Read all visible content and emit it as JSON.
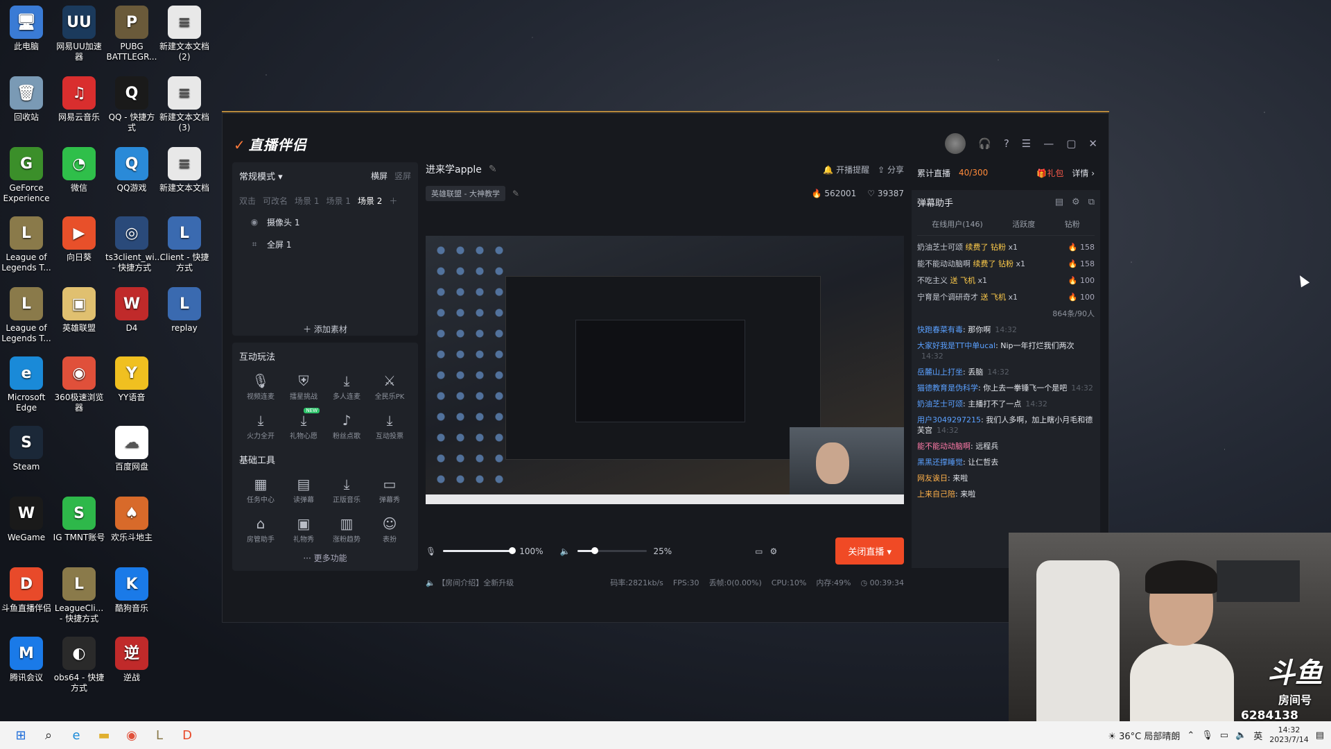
{
  "desktop": {
    "icons": [
      {
        "label": "此电脑",
        "icon": "computer-icon",
        "color": "#3a7bd5",
        "glyph": "🖥"
      },
      {
        "label": "网易UU加速器",
        "icon": "uu-accelerator-icon",
        "color": "#1b3a5c",
        "glyph": "UU"
      },
      {
        "label": "PUBG BATTLEGR...",
        "icon": "pubg-icon",
        "color": "#6a5a3a",
        "glyph": "P"
      },
      {
        "label": "新建文本文档 (2)",
        "icon": "text-file-icon",
        "color": "#e8e8e8",
        "glyph": "≡"
      },
      {
        "label": "回收站",
        "icon": "recycle-bin-icon",
        "color": "#7a9ab5",
        "glyph": "🗑"
      },
      {
        "label": "网易云音乐",
        "icon": "netease-music-icon",
        "color": "#d92e2e",
        "glyph": "♫"
      },
      {
        "label": "QQ - 快捷方式",
        "icon": "qq-icon",
        "color": "#1a1a1a",
        "glyph": "Q"
      },
      {
        "label": "新建文本文档 (3)",
        "icon": "text-file-icon",
        "color": "#e8e8e8",
        "glyph": "≡"
      },
      {
        "label": "GeForce Experience",
        "icon": "geforce-icon",
        "color": "#3b8f2a",
        "glyph": "G"
      },
      {
        "label": "微信",
        "icon": "wechat-icon",
        "color": "#2fbf4a",
        "glyph": "◔"
      },
      {
        "label": "QQ游戏",
        "icon": "qq-game-icon",
        "color": "#2a8ad8",
        "glyph": "Q"
      },
      {
        "label": "新建文本文档",
        "icon": "text-file-icon",
        "color": "#e8e8e8",
        "glyph": "≡"
      },
      {
        "label": "League of Legends T...",
        "icon": "lol-icon",
        "color": "#8a7a4a",
        "glyph": "L"
      },
      {
        "label": "向日葵",
        "icon": "sunflower-icon",
        "color": "#e8502a",
        "glyph": "▶"
      },
      {
        "label": "ts3client_wi... - 快捷方式",
        "icon": "teamspeak-icon",
        "color": "#2a4a7a",
        "glyph": "◎"
      },
      {
        "label": "Client - 快捷方式",
        "icon": "lol-client-icon",
        "color": "#3a6ab0",
        "glyph": "L"
      },
      {
        "label": "League of Legends T...",
        "icon": "lol-icon",
        "color": "#8a7a4a",
        "glyph": "L"
      },
      {
        "label": "英雄联盟",
        "icon": "lol-folder-icon",
        "color": "#e0c070",
        "glyph": "▣"
      },
      {
        "label": "D4",
        "icon": "d4-icon",
        "color": "#c02a2a",
        "glyph": "W"
      },
      {
        "label": "replay",
        "icon": "replay-icon",
        "color": "#3a6ab0",
        "glyph": "L"
      },
      {
        "label": "Microsoft Edge",
        "icon": "edge-icon",
        "color": "#1a8ad8",
        "glyph": "e"
      },
      {
        "label": "360极速浏览器",
        "icon": "360-browser-icon",
        "color": "#e0503a",
        "glyph": "◉"
      },
      {
        "label": "YY语音",
        "icon": "yy-icon",
        "color": "#f0c020",
        "glyph": "Y"
      },
      {
        "label": "Steam",
        "icon": "steam-icon",
        "color": "#1b2838",
        "glyph": "S"
      },
      {
        "label": "百度网盘",
        "icon": "baidu-netdisk-icon",
        "color": "#ffffff",
        "glyph": "☁"
      },
      {
        "label": "WeGame",
        "icon": "wegame-icon",
        "color": "#1a1a1a",
        "glyph": "W"
      },
      {
        "label": "IG TMNT账号",
        "icon": "ig-tmnt-icon",
        "color": "#2eb84a",
        "glyph": "S"
      },
      {
        "label": "欢乐斗地主",
        "icon": "doudizhu-icon",
        "color": "#d86a2a",
        "glyph": "♠"
      },
      {
        "label": "斗鱼直播伴侣",
        "icon": "douyu-companion-icon",
        "color": "#e84a2a",
        "glyph": "D"
      },
      {
        "label": "LeagueCli... - 快捷方式",
        "icon": "lol-client-icon",
        "color": "#8a7a4a",
        "glyph": "L"
      },
      {
        "label": "酷狗音乐",
        "icon": "kugou-icon",
        "color": "#1a7ae8",
        "glyph": "K"
      },
      {
        "label": "腾讯会议",
        "icon": "tencent-meeting-icon",
        "color": "#1a7ae8",
        "glyph": "M"
      },
      {
        "label": "obs64 - 快捷方式",
        "icon": "obs-icon",
        "color": "#2a2a2a",
        "glyph": "◐"
      },
      {
        "label": "逆战",
        "icon": "nizhan-icon",
        "color": "#c02a2a",
        "glyph": "逆"
      }
    ]
  },
  "app": {
    "name": "直播伴侣",
    "left": {
      "mode": "常规模式",
      "orient_h": "横屏",
      "orient_v": "竖屏",
      "scenes": [
        "双击",
        "可改名",
        "场景 1",
        "场景 1",
        "场景 2"
      ],
      "sources": [
        {
          "label": "摄像头 1",
          "icon": "camera-icon"
        },
        {
          "label": "全屏 1",
          "icon": "fullscreen-icon"
        }
      ],
      "add_source": "添加素材",
      "interactive_title": "互动玩法",
      "interactive": [
        {
          "label": "视频连麦",
          "icon": "mic-link-icon",
          "glyph": "🎙"
        },
        {
          "label": "擂星挑战",
          "icon": "shield-icon",
          "glyph": "⛨"
        },
        {
          "label": "多人连麦",
          "icon": "download-icon",
          "glyph": "⤓"
        },
        {
          "label": "全民乐PK",
          "icon": "pk-icon",
          "glyph": "⚔"
        },
        {
          "label": "火力全开",
          "icon": "download-icon",
          "glyph": "⤓"
        },
        {
          "label": "礼物心愿",
          "icon": "download-icon",
          "glyph": "⤓",
          "badge": "NEW"
        },
        {
          "label": "粉丝点歌",
          "icon": "music-icon",
          "glyph": "♪"
        },
        {
          "label": "互动投票",
          "icon": "download-icon",
          "glyph": "⤓"
        }
      ],
      "basic_title": "基础工具",
      "basic": [
        {
          "label": "任务中心",
          "icon": "task-icon",
          "glyph": "▦"
        },
        {
          "label": "读弹幕",
          "icon": "read-danmu-icon",
          "glyph": "▤"
        },
        {
          "label": "正版音乐",
          "icon": "download-icon",
          "glyph": "⤓"
        },
        {
          "label": "弹幕秀",
          "icon": "tv-icon",
          "glyph": "▭"
        },
        {
          "label": "房管助手",
          "icon": "home-icon",
          "glyph": "⌂"
        },
        {
          "label": "礼物秀",
          "icon": "gift-tv-icon",
          "glyph": "▣"
        },
        {
          "label": "涨粉趋势",
          "icon": "chart-icon",
          "glyph": "▥"
        },
        {
          "label": "表扮",
          "icon": "face-icon",
          "glyph": "☺"
        }
      ],
      "more": "更多功能"
    },
    "center": {
      "room_title": "进来学apple",
      "reminder": "开播提醒",
      "share": "分享",
      "category": "英雄联盟 - 大神教学",
      "hot": "562001",
      "likes": "39387",
      "mic_volume": "100%",
      "mic_level": 1.0,
      "speaker_volume": "25%",
      "speaker_level": 0.25,
      "end_button": "关闭直播",
      "notice": "【房间介绍】全新升级",
      "bitrate": "码率:2821kb/s",
      "fps": "FPS:30",
      "drop": "丢帧:0(0.00%)",
      "cpu": "CPU:10%",
      "mem": "内存:49%",
      "duration": "00:39:34"
    },
    "right": {
      "cumulative": "累计直播",
      "count": "40/300",
      "gift": "礼包",
      "detail": "详情",
      "assistant": "弹幕助手",
      "tabs": [
        "在线用户(146)",
        "活跃度",
        "钻粉"
      ],
      "gifts": [
        {
          "user": "奶油芝士可颂",
          "action": "续费了",
          "item": "钻粉",
          "qty": "x1",
          "amt": "158"
        },
        {
          "user": "能不能动动脑啊",
          "action": "续费了",
          "item": "钻粉",
          "qty": "x1",
          "amt": "158"
        },
        {
          "user": "不吃主义",
          "action": "送",
          "item": "飞机",
          "qty": "x1",
          "amt": "100"
        },
        {
          "user": "宁育是个调研奇才",
          "action": "送",
          "item": "飞机",
          "qty": "x1",
          "amt": "100"
        }
      ],
      "gift_count": "864条/90人",
      "chats": [
        {
          "user": "快跑春菜有毒",
          "text": "那你啊",
          "time": "14:32",
          "cls": ""
        },
        {
          "user": "大家好我是TT中单ucal",
          "text": "Nip一年打烂我们两次",
          "time": "14:32",
          "cls": ""
        },
        {
          "user": "岳麓山上打坐",
          "text": "丢脑",
          "time": "14:32",
          "cls": ""
        },
        {
          "user": "猫德教育是伪科学",
          "text": "你上去一拳锤飞一个是吧",
          "time": "14:32",
          "cls": ""
        },
        {
          "user": "奶油芝士可颂",
          "text": "主播打不了一点",
          "time": "14:32",
          "cls": ""
        },
        {
          "user": "用户3049297215",
          "text": "我们人多啊，加上瞎小月毛和德芙宫",
          "time": "14:32",
          "cls": ""
        },
        {
          "user": "能不能动动脑啊",
          "text": "远程兵",
          "time": "",
          "cls": "pink"
        },
        {
          "user": "黑黑还撑睡觉",
          "text": "让仁哲去",
          "time": "",
          "cls": ""
        },
        {
          "user": "网友诶日",
          "text": "来啦",
          "time": "",
          "cls": "orange"
        },
        {
          "user": "上来自己陪",
          "text": "来啦",
          "time": "",
          "cls": "orange"
        }
      ]
    }
  },
  "overlay": {
    "platform": "斗鱼",
    "room_label": "房间号",
    "room_number": "6284138"
  },
  "taskbar": {
    "weather": "36°C 局部晴朗",
    "ime": "英",
    "time": "14:32",
    "date": "2023/7/14"
  }
}
